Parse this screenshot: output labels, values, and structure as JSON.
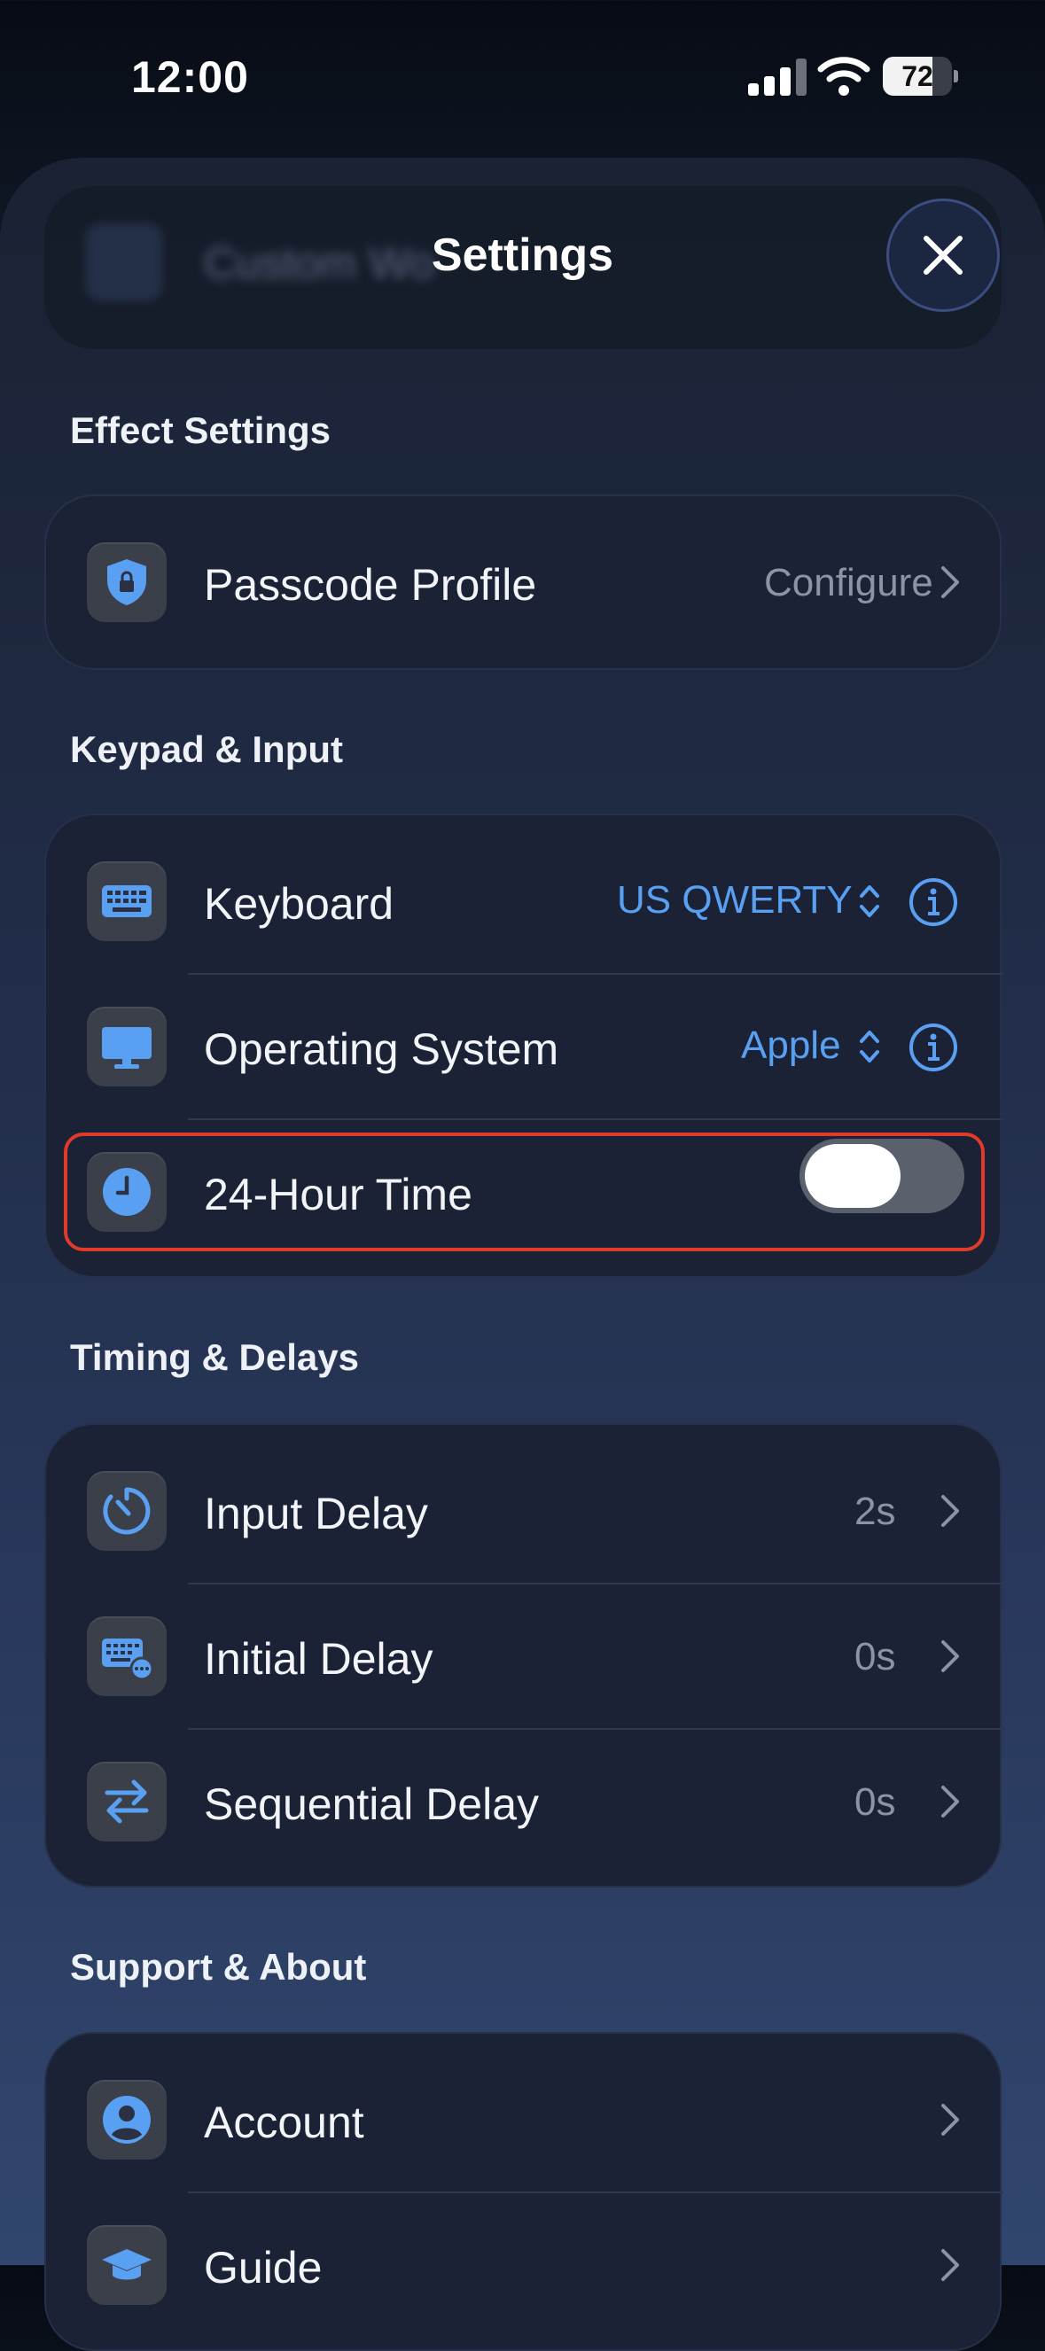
{
  "status_bar": {
    "time": "12:00",
    "battery": "72",
    "battery_level": 0.72
  },
  "header": {
    "title": "Settings",
    "ghost_text": "Custom Wo"
  },
  "sections": {
    "effect": {
      "title": "Effect Settings",
      "rows": [
        {
          "label": "Passcode Profile",
          "value": "Configure",
          "icon": "shield-lock-icon"
        }
      ]
    },
    "keypad": {
      "title": "Keypad & Input",
      "rows": [
        {
          "label": "Keyboard",
          "value": "US QWERTY",
          "icon": "keyboard-icon"
        },
        {
          "label": "Operating System",
          "value": "Apple",
          "icon": "monitor-icon"
        },
        {
          "label": "24-Hour Time",
          "icon": "clock-icon",
          "toggle_on": false
        }
      ]
    },
    "timing": {
      "title": "Timing & Delays",
      "rows": [
        {
          "label": "Input Delay",
          "value": "2s",
          "icon": "timer-icon"
        },
        {
          "label": "Initial Delay",
          "value": "0s",
          "icon": "keyboard-ellipsis-icon"
        },
        {
          "label": "Sequential Delay",
          "value": "0s",
          "icon": "arrows-swap-icon"
        }
      ]
    },
    "support": {
      "title": "Support & About",
      "rows": [
        {
          "label": "Account",
          "icon": "person-circle-icon"
        },
        {
          "label": "Guide",
          "icon": "graduation-cap-icon"
        }
      ]
    }
  },
  "colors": {
    "accent": "#5AA0F2",
    "highlight": "#E03B2A",
    "card": "#1B2235"
  }
}
